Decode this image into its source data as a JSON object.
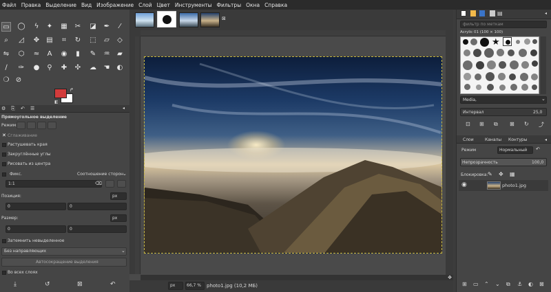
{
  "menu": [
    "Файл",
    "Правка",
    "Выделение",
    "Вид",
    "Изображение",
    "Слой",
    "Цвет",
    "Инструменты",
    "Фильтры",
    "Окна",
    "Справка"
  ],
  "colors": {
    "foreground": "#d23b3b",
    "background": "#ffffff",
    "selection": "#c8b840"
  },
  "tool_options": {
    "title": "Прямоугольное выделение",
    "mode_label": "Режим:",
    "antialias": "Сглаживание",
    "feather": "Растушевать края",
    "rounded": "Закруглённые углы",
    "expand_center": "Рисовать из центра",
    "fixed": "Фикс.",
    "fixed_value": "Соотношение сторон",
    "ratio": "1:1",
    "position_label": "Позиция:",
    "size_label": "Размер:",
    "unit": "px",
    "pos_x": "0",
    "pos_y": "0",
    "size_w": "0",
    "size_h": "0",
    "highlight": "Затемнить невыделенное",
    "guides": "Без направляющих",
    "autoshrink": "Автосокращение выделения",
    "all_layers": "Во всех слоях"
  },
  "status": {
    "unit": "px",
    "zoom": "66,7 %",
    "file": "photo1.jpg (10,2 МБ)"
  },
  "brushes": {
    "filter_placeholder": "фильтр по меткам",
    "name": "Acrylic 01 (100 × 100)",
    "tag": "Media,",
    "spacing_label": "Интервал",
    "spacing_value": "25,0"
  },
  "layers": {
    "tabs": [
      "Слои",
      "Каналы",
      "Контуры"
    ],
    "mode_label": "Режим",
    "mode_value": "Нормальный",
    "opacity_label": "Непрозрачность",
    "opacity_value": "100,0",
    "lock_label": "Блокировка:",
    "items": [
      {
        "name": "photo1.jpg"
      }
    ]
  }
}
